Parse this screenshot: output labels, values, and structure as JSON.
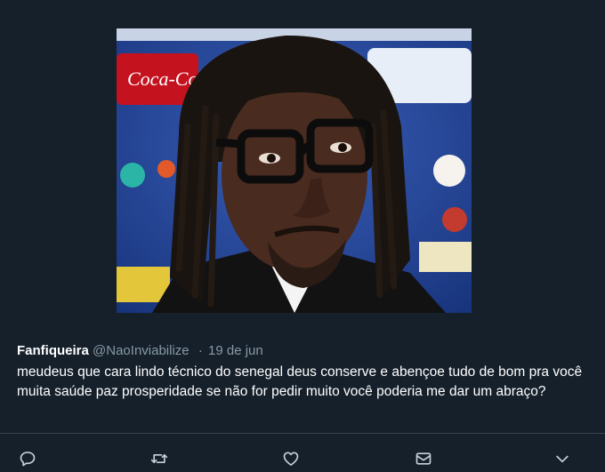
{
  "tweet": {
    "display_name": "Fanfiqueira",
    "handle": "@NaoInviabilize",
    "separator": "·",
    "date": "19 de jun",
    "text": "meudeus que cara lindo técnico do senegal deus conserve e abençoe tudo de bom pra você muita saúde paz prosperidade se não for pedir muito você poderia me dar um abraço?"
  },
  "media": {
    "backdrop_logo": "Coca-Cola"
  },
  "actions": [
    {
      "name": "reply-icon"
    },
    {
      "name": "retweet-icon"
    },
    {
      "name": "like-icon"
    },
    {
      "name": "direct-message-icon"
    },
    {
      "name": "chevron-down-icon"
    }
  ],
  "colors": {
    "background": "#15202b",
    "primary_text": "#ffffff",
    "secondary_text": "#8899a6",
    "divider": "#38444d"
  }
}
